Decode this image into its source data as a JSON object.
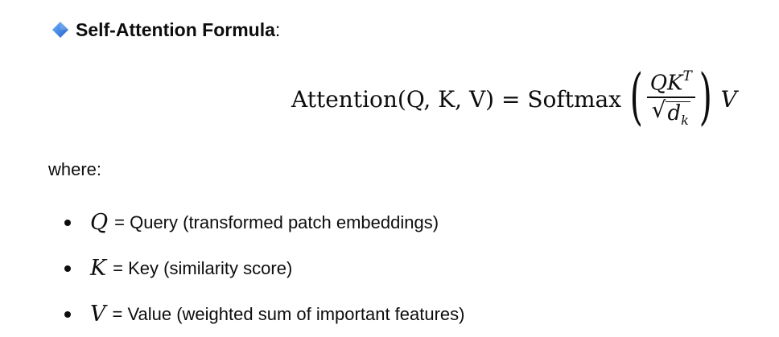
{
  "heading": {
    "icon": "blue-diamond-icon",
    "icon_color": "#2f7fe0",
    "title": "Self-Attention Formula",
    "suffix": ":"
  },
  "formula": {
    "lhs": "Attention(Q, K, V) = Softmax",
    "numerator": "QK",
    "numerator_sup": "T",
    "denominator": "d",
    "denominator_sub": "k",
    "trailing": "V"
  },
  "where_label": "where:",
  "definitions": [
    {
      "symbol": "Q",
      "text": "= Query (transformed patch embeddings)"
    },
    {
      "symbol": "K",
      "text": "= Key (similarity score)"
    },
    {
      "symbol": "V",
      "text": "= Value (weighted sum of important features)"
    }
  ]
}
